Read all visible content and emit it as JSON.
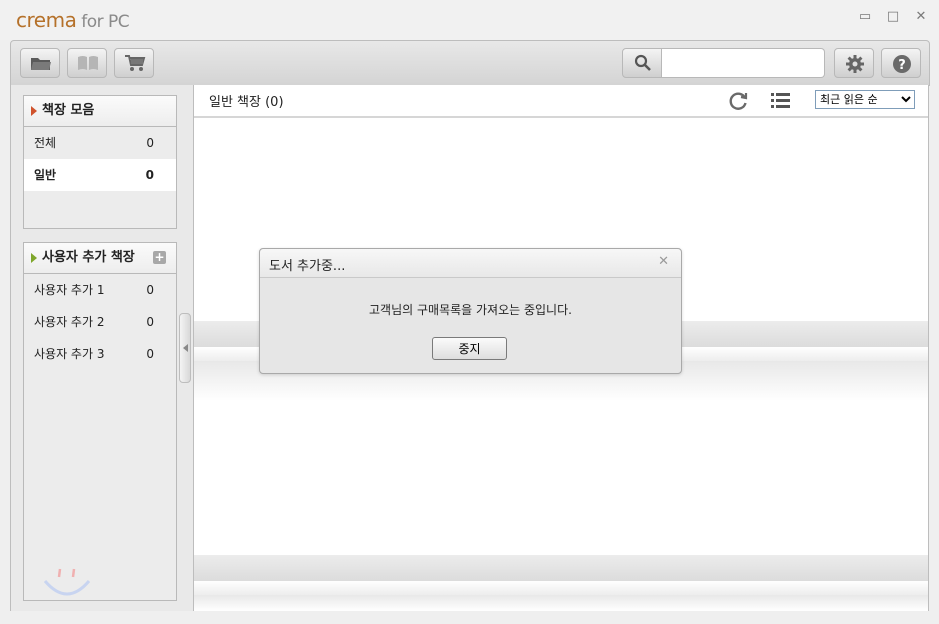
{
  "app": {
    "logo_main": "crema",
    "logo_suffix": " for PC"
  },
  "window": {
    "minimize": "▭",
    "maximize": "□",
    "close": "✕"
  },
  "search": {
    "placeholder": "",
    "value": ""
  },
  "sidebar": {
    "collection": {
      "title": "책장 모음",
      "items": [
        {
          "label": "전체",
          "count": "0"
        },
        {
          "label": "일반",
          "count": "0"
        }
      ]
    },
    "custom": {
      "title": "사용자 추가 책장",
      "add_symbol": "+",
      "items": [
        {
          "label": "사용자 추가 1",
          "count": "0"
        },
        {
          "label": "사용자 추가 2",
          "count": "0"
        },
        {
          "label": "사용자 추가 3",
          "count": "0"
        }
      ]
    }
  },
  "main": {
    "title": "일반 책장 (0)",
    "sort": {
      "selected": "최근 읽은 순"
    }
  },
  "dialog": {
    "title": "도서 추가중...",
    "close_symbol": "✕",
    "message": "고객님의 구매목록을 가져오는 중입니다.",
    "button": "중지"
  },
  "colors": {
    "accent_logo": "#b5712a",
    "selected_arrow": "#d0532d",
    "custom_arrow": "#7ea62b"
  }
}
